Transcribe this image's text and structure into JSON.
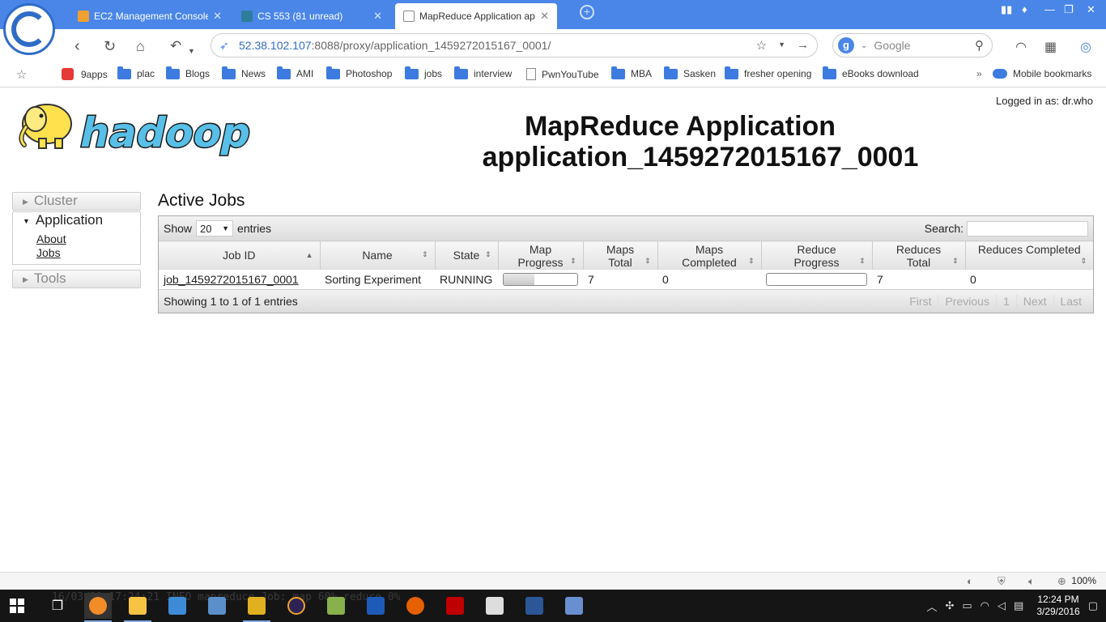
{
  "browser": {
    "tabs": [
      {
        "title": "EC2 Management Console",
        "active": false,
        "favicon_color": "#f0a030"
      },
      {
        "title": "CS 553 (81 unread)",
        "active": false,
        "favicon_color": "#2e7d9c"
      },
      {
        "title": "MapReduce Application ap",
        "active": true,
        "favicon_color": "#ffffff"
      }
    ],
    "url_host": "52.38.102.107",
    "url_rest": ":8088/proxy/application_1459272015167_0001/",
    "search_engine": "Google",
    "bookmarks": [
      {
        "label": "9apps",
        "icon": "red-app-icon"
      },
      {
        "label": "plac",
        "icon": "folder-icon"
      },
      {
        "label": "Blogs",
        "icon": "folder-icon"
      },
      {
        "label": "News",
        "icon": "folder-icon"
      },
      {
        "label": "AMI",
        "icon": "folder-icon"
      },
      {
        "label": "Photoshop",
        "icon": "folder-icon"
      },
      {
        "label": "jobs",
        "icon": "folder-icon"
      },
      {
        "label": "interview",
        "icon": "folder-icon"
      },
      {
        "label": "PwnYouTube",
        "icon": "page-icon"
      },
      {
        "label": "MBA",
        "icon": "folder-icon"
      },
      {
        "label": "Sasken",
        "icon": "folder-icon"
      },
      {
        "label": "fresher opening",
        "icon": "folder-icon"
      },
      {
        "label": "eBooks download",
        "icon": "folder-icon"
      }
    ],
    "more_bookmarks": "»",
    "mobile_bookmarks": "Mobile bookmarks",
    "zoom_level": "100%"
  },
  "page": {
    "logo_text": "hadoop",
    "logged_in": "Logged in as: dr.who",
    "heading_line1": "MapReduce Application",
    "heading_line2": "application_1459272015167_0001",
    "nav": {
      "cluster": "Cluster",
      "application": "Application",
      "about": "About",
      "jobs": "Jobs",
      "tools": "Tools"
    },
    "section_title": "Active Jobs",
    "show_label": "Show",
    "show_value": "20",
    "entries_label": "entries",
    "search_label": "Search:",
    "columns": [
      "Job ID",
      "Name",
      "State",
      "Map Progress",
      "Maps Total",
      "Maps Completed",
      "Reduce Progress",
      "Reduces Total",
      "Reduces Completed"
    ],
    "rows": [
      {
        "job_id": "job_1459272015167_0001",
        "name": "Sorting Experiment",
        "state": "RUNNING",
        "map_progress": 0.42,
        "maps_total": "7",
        "maps_completed": "0",
        "reduce_progress": 0,
        "reduces_total": "7",
        "reduces_completed": "0"
      }
    ],
    "info": "Showing 1 to 1 of 1 entries",
    "pager": [
      "First",
      "Previous",
      "1",
      "Next",
      "Last"
    ]
  },
  "taskbar": {
    "terminal_ghost": "16/03/29 17:24:21 INFO mapreduce.Job:  map 60% reduce 0%",
    "time": "12:24 PM",
    "date": "3/29/2016"
  }
}
